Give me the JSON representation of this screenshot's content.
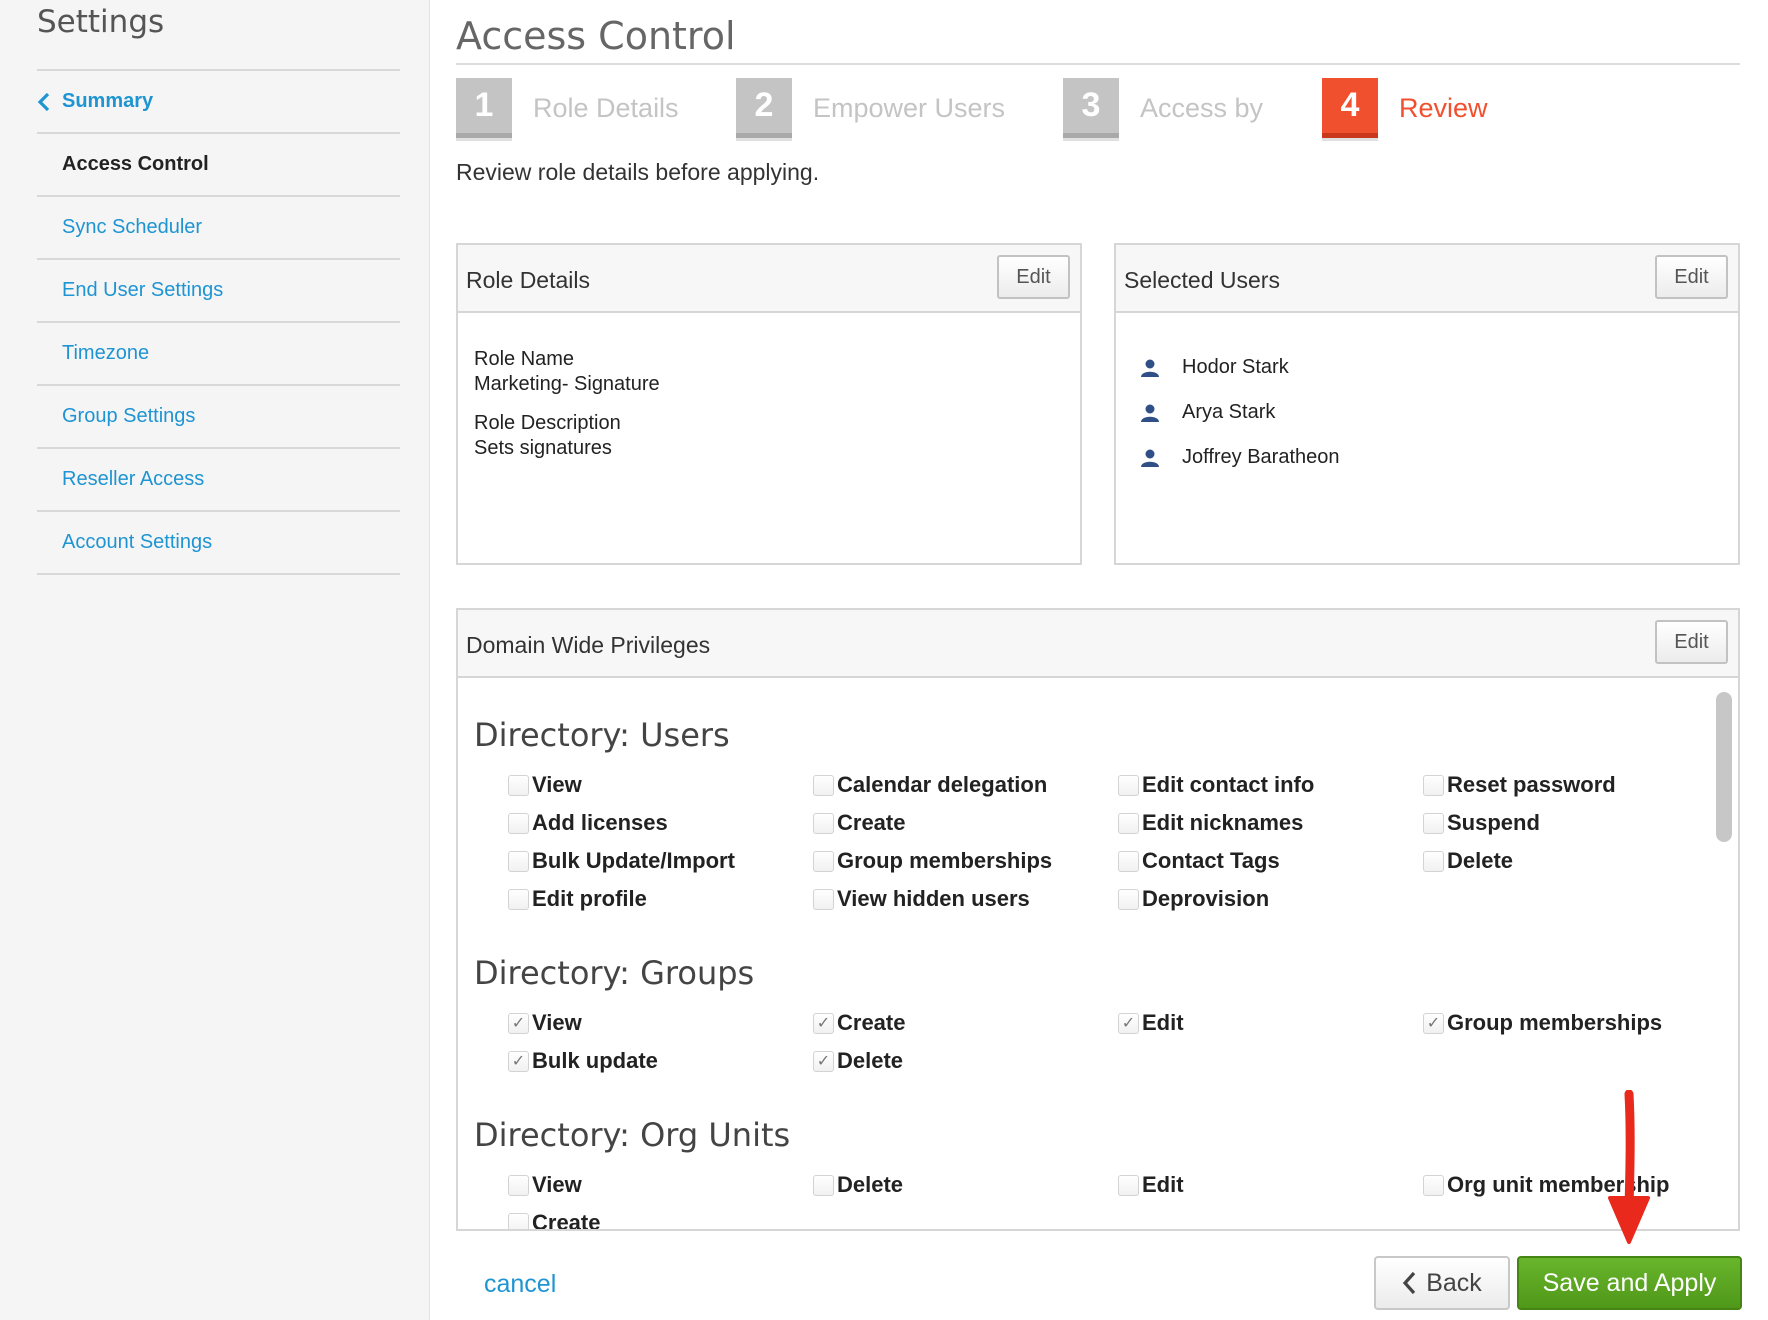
{
  "sidebar": {
    "title": "Settings",
    "items": [
      {
        "label": "Summary"
      },
      {
        "label": "Access Control"
      },
      {
        "label": "Sync Scheduler"
      },
      {
        "label": "End User Settings"
      },
      {
        "label": "Timezone"
      },
      {
        "label": "Group Settings"
      },
      {
        "label": "Reseller Access"
      },
      {
        "label": "Account Settings"
      }
    ]
  },
  "main": {
    "title": "Access Control",
    "steps": [
      {
        "num": "1",
        "label": "Role Details"
      },
      {
        "num": "2",
        "label": "Empower Users"
      },
      {
        "num": "3",
        "label": "Access by"
      },
      {
        "num": "4",
        "label": "Review"
      }
    ],
    "instruction": "Review role details before applying.",
    "edit_label": "Edit",
    "role_details": {
      "title": "Role Details",
      "name_label": "Role Name",
      "name_value": "Marketing- Signature",
      "desc_label": "Role Description",
      "desc_value": "Sets signatures"
    },
    "selected_users": {
      "title": "Selected Users",
      "users": [
        "Hodor Stark",
        "Arya Stark",
        "Joffrey Baratheon"
      ]
    },
    "privileges": {
      "title": "Domain Wide Privileges",
      "sections": [
        {
          "title": "Directory: Users",
          "items": [
            {
              "label": "View",
              "checked": false
            },
            {
              "label": "Calendar delegation",
              "checked": false
            },
            {
              "label": "Edit contact info",
              "checked": false
            },
            {
              "label": "Reset password",
              "checked": false
            },
            {
              "label": "Add licenses",
              "checked": false
            },
            {
              "label": "Create",
              "checked": false
            },
            {
              "label": "Edit nicknames",
              "checked": false
            },
            {
              "label": "Suspend",
              "checked": false
            },
            {
              "label": "Bulk Update/Import",
              "checked": false
            },
            {
              "label": "Group memberships",
              "checked": false
            },
            {
              "label": "Contact Tags",
              "checked": false
            },
            {
              "label": "Delete",
              "checked": false
            },
            {
              "label": "Edit profile",
              "checked": false
            },
            {
              "label": "View hidden users",
              "checked": false
            },
            {
              "label": "Deprovision",
              "checked": false
            }
          ]
        },
        {
          "title": "Directory: Groups",
          "items": [
            {
              "label": "View",
              "checked": true
            },
            {
              "label": "Create",
              "checked": true
            },
            {
              "label": "Edit",
              "checked": true
            },
            {
              "label": "Group memberships",
              "checked": true
            },
            {
              "label": "Bulk update",
              "checked": true
            },
            {
              "label": "Delete",
              "checked": true
            }
          ]
        },
        {
          "title": "Directory: Org Units",
          "items": [
            {
              "label": "View",
              "checked": false
            },
            {
              "label": "Delete",
              "checked": false
            },
            {
              "label": "Edit",
              "checked": false
            },
            {
              "label": "Org unit membership",
              "checked": false
            },
            {
              "label": "Create",
              "checked": false
            }
          ]
        }
      ]
    }
  },
  "footer": {
    "cancel_label": "cancel",
    "back_label": "Back",
    "save_label": "Save and Apply"
  },
  "colors": {
    "accent_blue": "#1e94d2",
    "active_step": "#f1502f",
    "inactive_step": "#c4c4c4",
    "save_green": "#5ba822",
    "annotation_arrow": "#e8291c"
  }
}
